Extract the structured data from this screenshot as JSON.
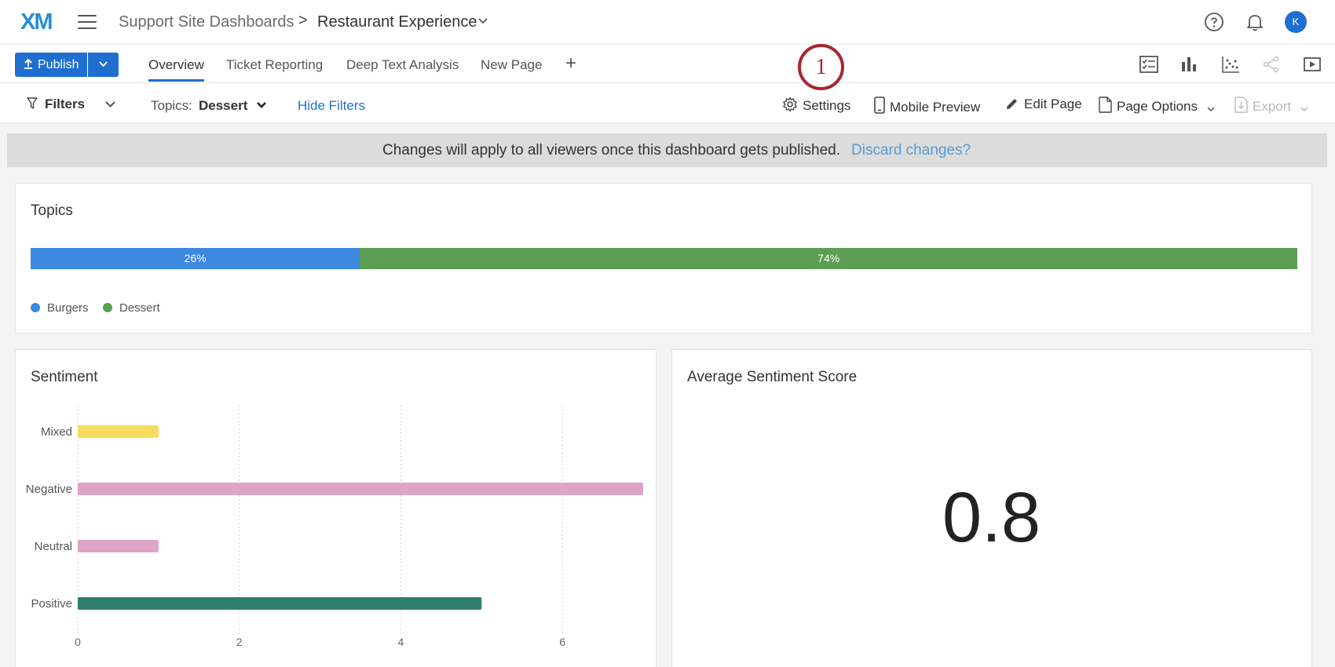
{
  "app": {
    "logo_text": "XM",
    "breadcrumb": {
      "parent": "Support Site Dashboards",
      "separator": ">",
      "current": "Restaurant Experience"
    },
    "avatar_initial": "K"
  },
  "toolbar": {
    "publish_label": "Publish",
    "tabs": [
      {
        "label": "Overview",
        "active": true
      },
      {
        "label": "Ticket Reporting",
        "active": false
      },
      {
        "label": "Deep Text Analysis",
        "active": false
      },
      {
        "label": "New Page",
        "active": false
      }
    ],
    "add_tab_symbol": "+"
  },
  "callout": {
    "number": "1"
  },
  "filters": {
    "label": "Filters",
    "topics_label": "Topics:",
    "topics_value": "Dessert",
    "hide_label": "Hide Filters"
  },
  "actions": {
    "settings": "Settings",
    "mobile_preview": "Mobile Preview",
    "edit_page": "Edit Page",
    "page_options": "Page Options",
    "export": "Export"
  },
  "banner": {
    "message": "Changes will apply to all viewers once this dashboard gets published.",
    "link": "Discard changes?"
  },
  "widgets": {
    "topics": {
      "title": "Topics"
    },
    "sentiment": {
      "title": "Sentiment"
    },
    "average": {
      "title": "Average Sentiment Score",
      "value": "0.8"
    }
  },
  "chart_data": [
    {
      "type": "bar",
      "orientation": "stacked-horizontal",
      "categories": [
        "Burgers",
        "Dessert"
      ],
      "values": [
        26,
        74
      ],
      "data_labels": [
        "26%",
        "74%"
      ],
      "colors": [
        "#3d88e0",
        "#5b9d52"
      ],
      "legend": "bottom-left"
    },
    {
      "type": "bar",
      "orientation": "horizontal",
      "categories": [
        "Mixed",
        "Negative",
        "Neutral",
        "Positive"
      ],
      "values": [
        1,
        7,
        1,
        5
      ],
      "colors": [
        "#f7dc60",
        "#dea5c8",
        "#dea5c8",
        "#2e7f6e"
      ],
      "xlim": [
        0,
        7
      ],
      "xticks": [
        0,
        2,
        4,
        6
      ],
      "grid": true
    }
  ]
}
